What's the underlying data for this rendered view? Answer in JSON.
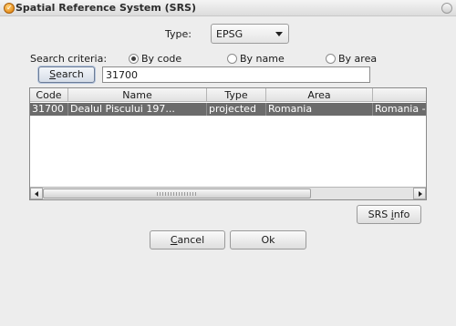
{
  "window": {
    "title": "Spatial Reference System (SRS)"
  },
  "type_row": {
    "label": "Type:",
    "selected": "EPSG"
  },
  "criteria": {
    "label": "Search criteria:",
    "options": [
      {
        "label": "By code",
        "selected": true
      },
      {
        "label": "By name",
        "selected": false
      },
      {
        "label": "By area",
        "selected": false
      }
    ]
  },
  "search": {
    "button_label_mnemonic": "S",
    "button_label_rest": "earch",
    "query": "31700"
  },
  "table": {
    "columns": [
      "Code",
      "Name",
      "Type",
      "Area",
      ""
    ],
    "rows": [
      {
        "code": "31700",
        "name": "Dealul Piscului 197...",
        "type": "projected",
        "area": "Romania",
        "description": "Romania - onsho"
      }
    ]
  },
  "buttons": {
    "srs_info_pre": "SRS ",
    "srs_info_mnemonic": "i",
    "srs_info_post": "nfo",
    "cancel_mnemonic": "C",
    "cancel_rest": "ancel",
    "ok": "Ok"
  }
}
